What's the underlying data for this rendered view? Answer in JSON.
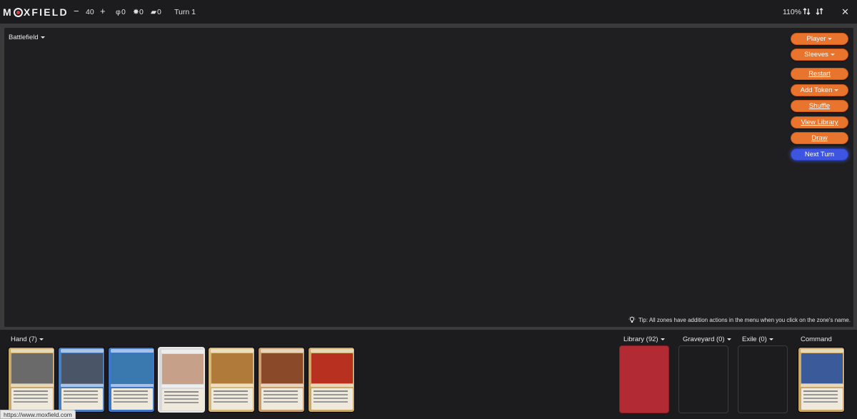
{
  "app": {
    "logo_text_1": "M",
    "logo_text_2": "XFIELD"
  },
  "topbar": {
    "life_minus": "−",
    "life": "40",
    "life_plus": "+",
    "poison_count": "0",
    "energy_count": "0",
    "experience_count": "0",
    "turn": "Turn 1",
    "zoom": "110%",
    "close": "✕"
  },
  "battlefield": {
    "label": "Battlefield"
  },
  "actions": {
    "player": "Player",
    "sleeves": "Sleeves",
    "restart": "Restart",
    "add_token": "Add Token",
    "shuffle": "Shuffle",
    "view_library": "View Library",
    "draw": "Draw",
    "next_turn": "Next Turn"
  },
  "tip": "Tip: All zones have addition actions in the menu when you click on the zone's name.",
  "zones": {
    "hand": "Hand (7)",
    "library": "Library (92)",
    "graveyard": "Graveyard (0)",
    "exile": "Exile (0)",
    "command": "Command"
  },
  "hand_cards": [
    {
      "frame": "#c9a868",
      "art": "#6a6a6a"
    },
    {
      "frame": "#4a7fbf",
      "art": "#4a5668"
    },
    {
      "frame": "#3d78c8",
      "art": "#3a78b0"
    },
    {
      "frame": "#d8d8d8",
      "art": "#c7a08a"
    },
    {
      "frame": "#d6b87a",
      "art": "#b07a3a"
    },
    {
      "frame": "#c8a070",
      "art": "#8a4a2a"
    },
    {
      "frame": "#c9a868",
      "art": "#b83020"
    }
  ],
  "command_card": {
    "frame": "#c9a868",
    "art": "#3a5a9a"
  },
  "library_color": "#b22a33",
  "status_url": "https://www.moxfield.com"
}
